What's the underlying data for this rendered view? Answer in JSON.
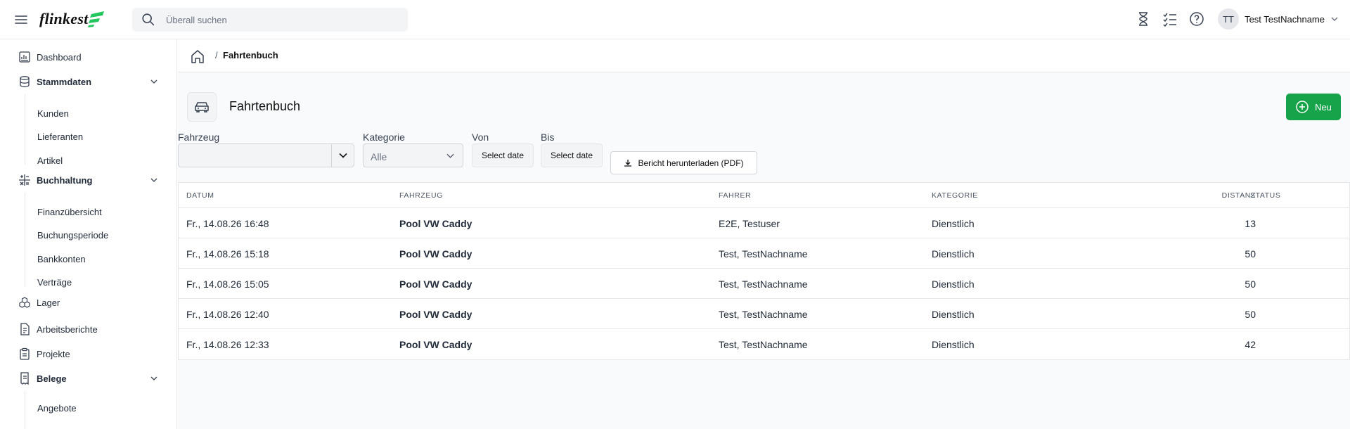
{
  "header": {
    "logo_text": "flinkest",
    "search_placeholder": "Überall suchen",
    "user_initials": "TT",
    "user_name": "Test TestNachname",
    "icons": [
      "hourglass-icon",
      "checklist-icon",
      "help-icon",
      "chevron-down-icon"
    ]
  },
  "sidebar": {
    "items": [
      {
        "label": "Dashboard",
        "icon": "dashboard-icon"
      },
      {
        "label": "Stammdaten",
        "icon": "database-icon",
        "expanded": true,
        "children": [
          "Kunden",
          "Lieferanten",
          "Artikel"
        ]
      },
      {
        "label": "Buchhaltung",
        "icon": "calculator-icon",
        "expanded": true,
        "children": [
          "Finanzübersicht",
          "Buchungsperiode",
          "Bankkonten",
          "Verträge"
        ]
      },
      {
        "label": "Lager",
        "icon": "boxes-icon"
      },
      {
        "label": "Arbeitsberichte",
        "icon": "document-icon"
      },
      {
        "label": "Projekte",
        "icon": "clipboard-icon"
      },
      {
        "label": "Belege",
        "icon": "receipt-icon",
        "expanded": true,
        "children": [
          "Angebote"
        ]
      }
    ]
  },
  "breadcrumb": {
    "separator": "/",
    "current": "Fahrtenbuch"
  },
  "page": {
    "title": "Fahrtenbuch",
    "new_button": "Neu"
  },
  "filters": {
    "fahrzeug_label": "Fahrzeug",
    "fahrzeug_value": "",
    "kategorie_label": "Kategorie",
    "kategorie_value": "Alle",
    "von_label": "Von",
    "von_button": "Select date",
    "bis_label": "Bis",
    "bis_button": "Select date",
    "pdf_button": "Bericht herunterladen (PDF)"
  },
  "table": {
    "columns": [
      "DATUM",
      "FAHRZEUG",
      "FAHRER",
      "KATEGORIE",
      "DISTANZ",
      "STATUS"
    ],
    "rows": [
      {
        "datum": "Fr., 14.08.26 16:48",
        "fahrzeug": "Pool VW Caddy",
        "fahrer": "E2E, Testuser",
        "kategorie": "Dienstlich",
        "distanz": "13",
        "status": ""
      },
      {
        "datum": "Fr., 14.08.26 15:18",
        "fahrzeug": "Pool VW Caddy",
        "fahrer": "Test, TestNachname",
        "kategorie": "Dienstlich",
        "distanz": "50",
        "status": ""
      },
      {
        "datum": "Fr., 14.08.26 15:05",
        "fahrzeug": "Pool VW Caddy",
        "fahrer": "Test, TestNachname",
        "kategorie": "Dienstlich",
        "distanz": "50",
        "status": ""
      },
      {
        "datum": "Fr., 14.08.26 12:40",
        "fahrzeug": "Pool VW Caddy",
        "fahrer": "Test, TestNachname",
        "kategorie": "Dienstlich",
        "distanz": "50",
        "status": ""
      },
      {
        "datum": "Fr., 14.08.26 12:33",
        "fahrzeug": "Pool VW Caddy",
        "fahrer": "Test, TestNachname",
        "kategorie": "Dienstlich",
        "distanz": "42",
        "status": ""
      }
    ]
  },
  "colors": {
    "accent": "#16a34a",
    "logo_green": "#22c55e"
  }
}
